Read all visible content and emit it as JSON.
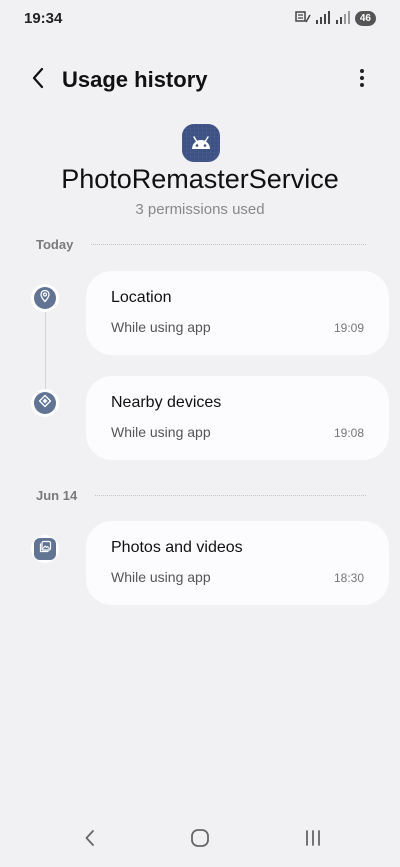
{
  "status_bar": {
    "time": "19:34",
    "battery": "46",
    "icons": [
      "wifi-calling-icon",
      "signal-icon",
      "signal-icon",
      "battery-icon"
    ]
  },
  "header": {
    "title": "Usage history",
    "back_icon": "chevron-left-icon",
    "more_icon": "more-vertical-icon"
  },
  "app": {
    "icon": "android-icon",
    "name": "PhotoRemasterService",
    "permissions_used": "3 permissions used"
  },
  "sections": [
    {
      "date": "Today",
      "items": [
        {
          "title": "Location",
          "subtitle": "While using app",
          "time": "19:09",
          "icon": "location-pin-icon"
        },
        {
          "title": "Nearby devices",
          "subtitle": "While using app",
          "time": "19:08",
          "icon": "nearby-devices-icon"
        }
      ]
    },
    {
      "date": "Jun 14",
      "items": [
        {
          "title": "Photos and videos",
          "subtitle": "While using app",
          "time": "18:30",
          "icon": "photos-icon"
        }
      ]
    }
  ],
  "nav": {
    "back_icon": "nav-back-icon",
    "home_icon": "nav-home-icon",
    "recents_icon": "nav-recents-icon"
  },
  "colors": {
    "background": "#f1f1f4",
    "card": "#fcfcfe",
    "icon_accent": "#617494",
    "app_icon_bg": "#3d5182"
  }
}
